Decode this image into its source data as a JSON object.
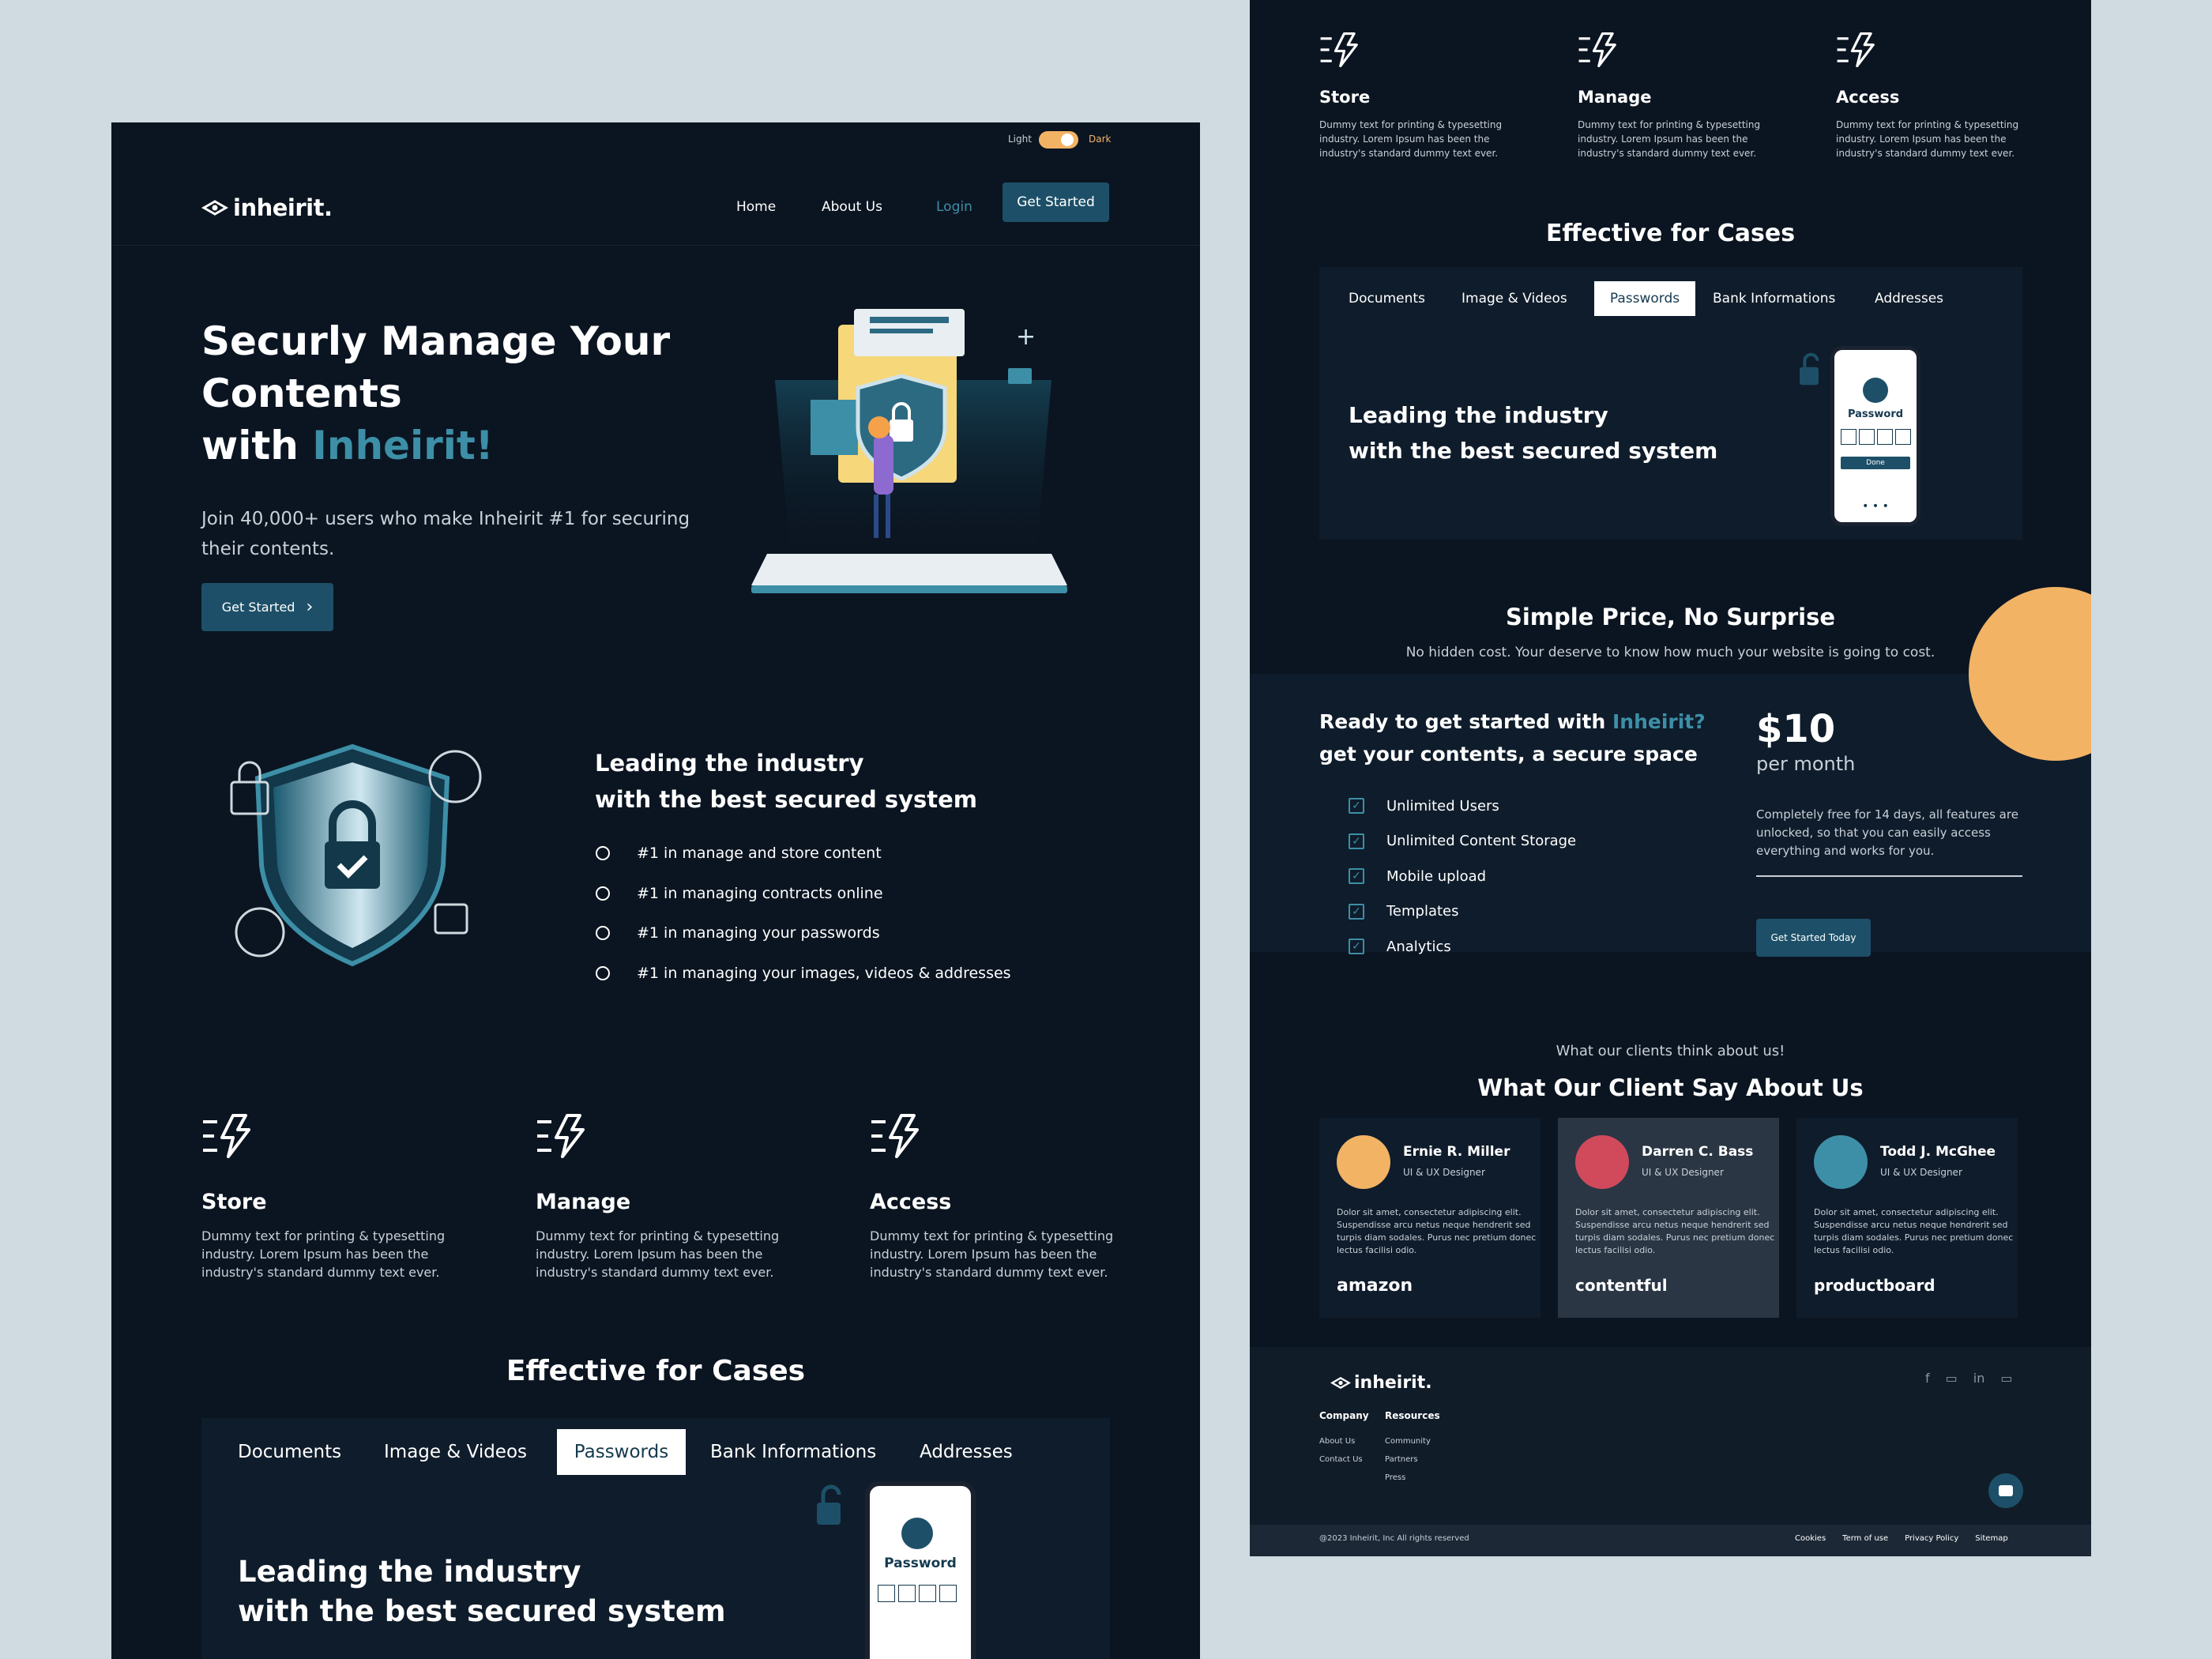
{
  "theme": {
    "light_label": "Light",
    "dark_label": "Dark"
  },
  "nav": {
    "logo": "inheirit.",
    "home": "Home",
    "about": "About Us",
    "login": "Login",
    "get_started": "Get Started"
  },
  "hero": {
    "title_line1": "Securly Manage Your",
    "title_line2": "Contents",
    "title_with": "with",
    "title_brand": "Inheirit!",
    "subtitle_line1": "Join 40,000+ users who make Inheirit #1 for securing",
    "subtitle_line2": "their contents.",
    "cta": "Get Started",
    "cta_arrow": "›"
  },
  "leading": {
    "title_line1": "Leading the industry",
    "title_line2": "with the best secured system",
    "items": [
      "#1 in manage and store content",
      "#1 in managing contracts online",
      "#1 in managing your passwords",
      "#1 in managing your images, videos & addresses"
    ]
  },
  "features": [
    {
      "title": "Store",
      "text_line1": "Dummy text for printing & typesetting",
      "text_line2": "industry. Lorem Ipsum has been the",
      "text_line3": "industry's standard dummy text ever."
    },
    {
      "title": "Manage",
      "text_line1": "Dummy text for printing & typesetting",
      "text_line2": "industry. Lorem Ipsum has been the",
      "text_line3": "industry's standard dummy text ever."
    },
    {
      "title": "Access",
      "text_line1": "Dummy text for printing & typesetting",
      "text_line2": "industry. Lorem Ipsum has been the",
      "text_line3": "industry's standard dummy text ever."
    }
  ],
  "cases": {
    "title": "Effective for Cases",
    "tabs": [
      "Documents",
      "Image & Videos",
      "Passwords",
      "Bank Informations",
      "Addresses"
    ],
    "active_tab": "Passwords",
    "panel_title_line1": "Leading the industry",
    "panel_title_line2": "with the best secured system",
    "phone_label": "Password",
    "phone_button": "Done",
    "phone_dots": "• • •"
  },
  "pricing": {
    "title": "Simple Price, No Surprise",
    "subtitle": "No hidden cost. Your deserve to know how much your website is going to cost.",
    "ready_prefix": "Ready to get started with ",
    "ready_brand": "Inheirit?",
    "ready_line2": "get your contents, a secure space",
    "features": [
      "Unlimited Users",
      "Unlimited Content Storage",
      "Mobile upload",
      "Templates",
      "Analytics"
    ],
    "price": "$10",
    "period": "per month",
    "desc_line1": "Completely free for 14 days, all features are",
    "desc_line2": "unlocked, so that you can easily access",
    "desc_line3": "everything and works for you.",
    "cta": "Get Started Today"
  },
  "testimonials": {
    "eyebrow": "What our clients think about us!",
    "title": "What Our Client Say About Us",
    "items": [
      {
        "name": "Ernie R. Miller",
        "role": "UI & UX Designer",
        "text_line1": "Dolor sit amet, consectetur adipiscing elit.",
        "text_line2": "Suspendisse arcu netus neque hendrerit sed",
        "text_line3": "turpis diam sodales. Purus nec pretium donec",
        "text_line4": "lectus facilisi odio.",
        "company": "amazon"
      },
      {
        "name": "Darren C. Bass",
        "role": "UI & UX Designer",
        "text_line1": "Dolor sit amet, consectetur adipiscing elit.",
        "text_line2": "Suspendisse arcu netus neque hendrerit sed",
        "text_line3": "turpis diam sodales. Purus nec pretium donec",
        "text_line4": "lectus facilisi odio.",
        "company": "contentful"
      },
      {
        "name": "Todd J. McGhee",
        "role": "UI & UX Designer",
        "text_line1": "Dolor sit amet, consectetur adipiscing elit.",
        "text_line2": "Suspendisse arcu netus neque hendrerit sed",
        "text_line3": "turpis diam sodales. Purus nec pretium donec",
        "text_line4": "lectus facilisi odio.",
        "company": "productboard"
      }
    ]
  },
  "footer": {
    "logo": "inheirit.",
    "company_title": "Company",
    "company_links": [
      "About Us",
      "Contact Us"
    ],
    "resources_title": "Resources",
    "resources_links": [
      "Community",
      "Partners",
      "Press"
    ],
    "copyright": "@2023 Inheirit, Inc All rights reserved",
    "legal_links": [
      "Cookies",
      "Term of use",
      "Privacy Policy",
      "Sitemap"
    ],
    "social_icons": [
      "facebook-icon",
      "chat-icon",
      "linkedin-icon",
      "message-icon"
    ]
  },
  "colors": {
    "bg": "#0b1521",
    "accent": "#3d8fa7",
    "button": "#1d5068",
    "orange": "#f2b365",
    "panel": "#0f1c2b"
  }
}
